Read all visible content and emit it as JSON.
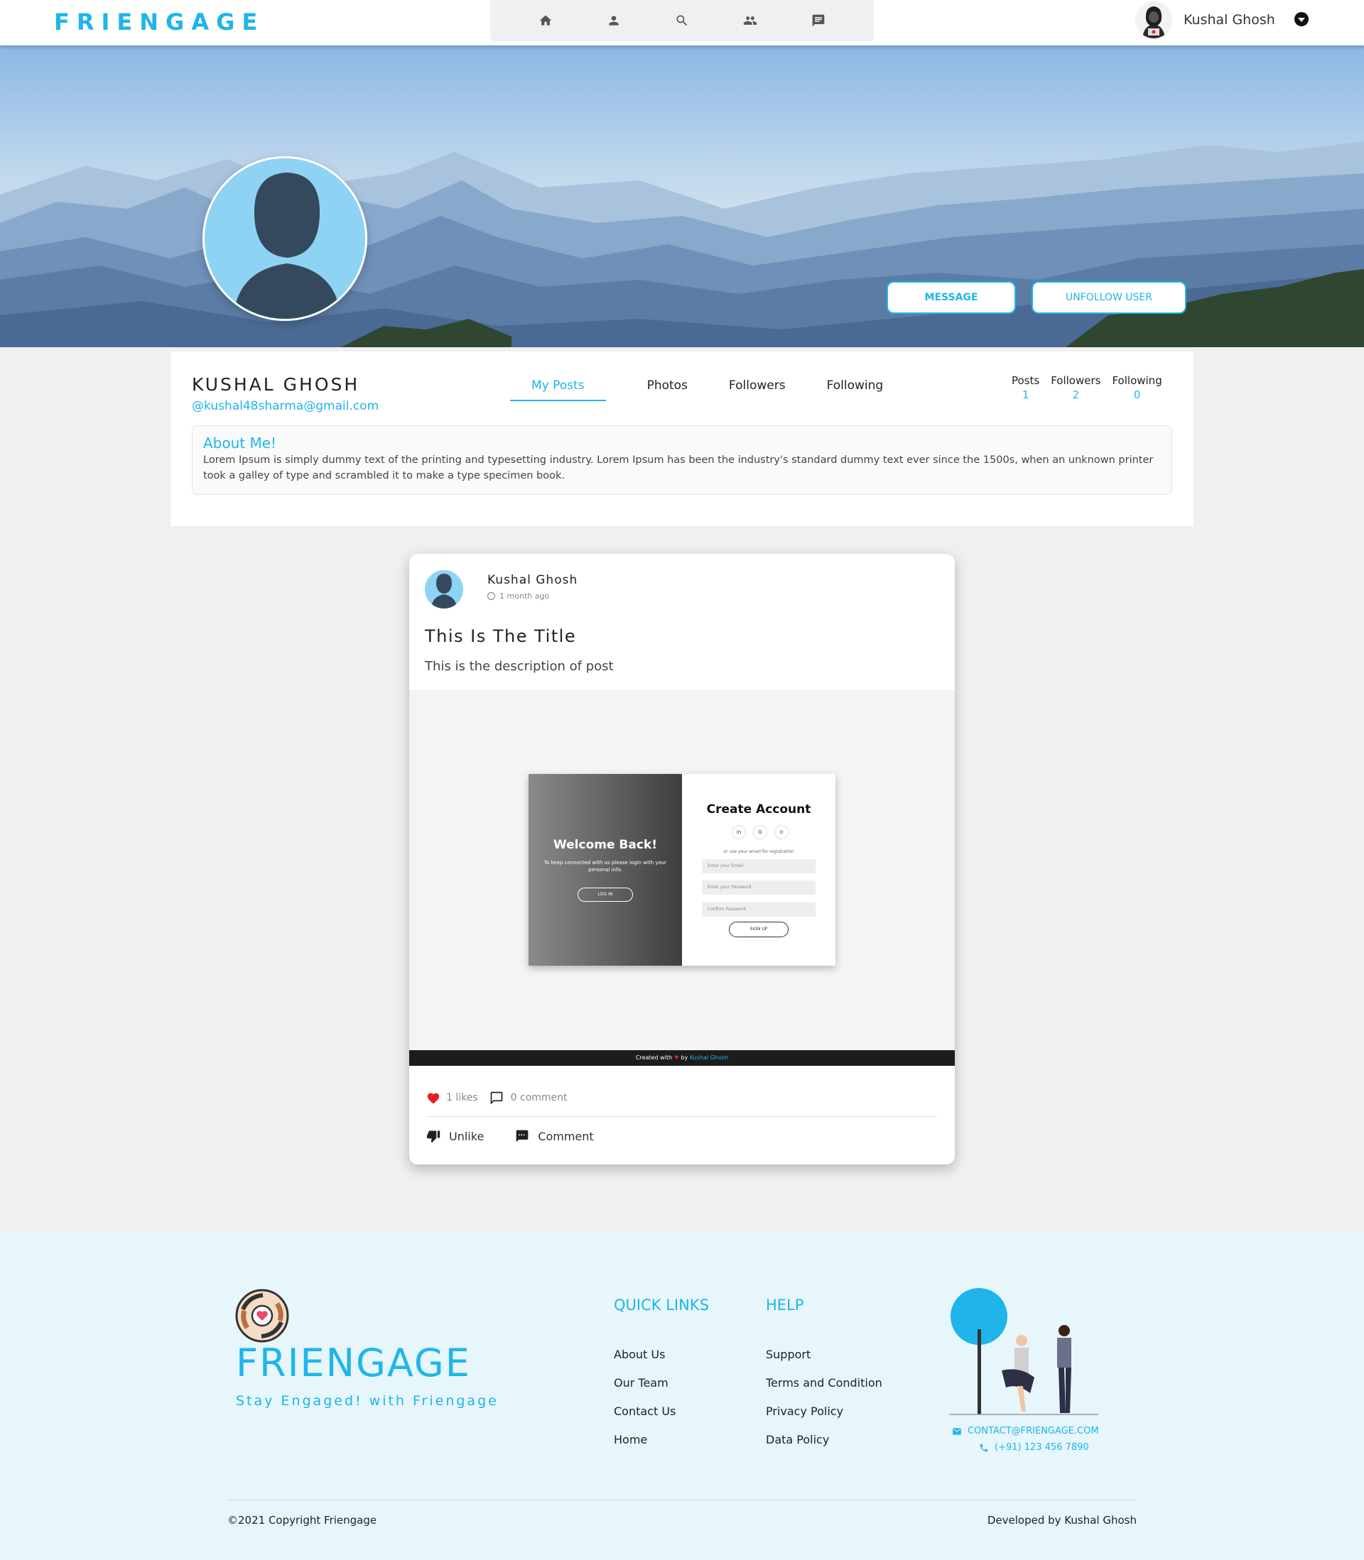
{
  "navbar": {
    "brand": "FRIENGAGE",
    "icons": [
      "home-icon",
      "profile-icon",
      "search-icon",
      "friends-icon",
      "chat-icon"
    ],
    "user_name": "Kushal Ghosh"
  },
  "cover": {
    "message_label": "MESSAGE",
    "unfollow_label": "UNFOLLOW USER"
  },
  "profile": {
    "name": "KUSHAL GHOSH",
    "email": "@kushal48sharma@gmail.com",
    "tabs": [
      "My Posts",
      "Photos",
      "Followers",
      "Following"
    ],
    "active_tab": "My Posts",
    "stats": [
      {
        "label": "Posts",
        "value": "1"
      },
      {
        "label": "Followers",
        "value": "2"
      },
      {
        "label": "Following",
        "value": "0"
      }
    ],
    "about_title": "About Me!",
    "about_text": "Lorem Ipsum is simply dummy text of the printing and typesetting industry. Lorem Ipsum has been the industry's standard dummy text ever since the 1500s, when an unknown printer took a galley of type and scrambled it to make a type specimen book."
  },
  "post": {
    "author": "Kushal Ghosh",
    "time": "1 month ago",
    "title": "This Is The Title",
    "description": "This is the description of post",
    "image": {
      "welcome_title": "Welcome Back!",
      "welcome_text": "To keep connected with us please login with your personal info.",
      "login_label": "LOG IN",
      "create_title": "Create Account",
      "social": [
        "in",
        "G",
        "⊙"
      ],
      "or_text": "or use your email for registration",
      "email_placeholder": "Enter your Email",
      "password_placeholder": "Enter your Password",
      "confirm_placeholder": "Confirm Password",
      "signup_label": "SIGN UP",
      "footer_prefix": "Created with",
      "footer_by": "by",
      "footer_name": "Kushal Ghosh"
    },
    "likes": "1 likes",
    "comments": "0 comment",
    "unlike_label": "Unlike",
    "comment_label": "Comment",
    "colors": {
      "accent": "#1fb5ea",
      "heart": "#e61e1e"
    }
  },
  "footer": {
    "brand": "FRIENGAGE",
    "tagline": "Stay Engaged! with Friengage",
    "quick_links_title": "QUICK LINKS",
    "quick_links": [
      "About Us",
      "Our Team",
      "Contact Us",
      "Home"
    ],
    "help_title": "HELP",
    "help_links": [
      "Support",
      "Terms and Condition",
      "Privacy Policy",
      "Data Policy"
    ],
    "email": "CONTACT@FRIENGAGE.COM",
    "phone": "(+91) 123 456 7890",
    "copyright": "©2021 Copyright Friengage",
    "developer": "Developed by Kushal Ghosh"
  }
}
